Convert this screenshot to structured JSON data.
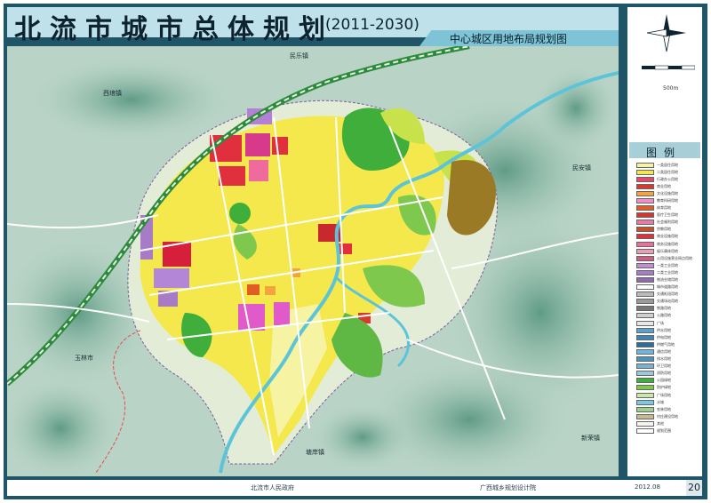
{
  "title": {
    "main": "北流市城市总体规划",
    "period": "(2011-2030)",
    "subtitle": "中心城区用地布局规划图"
  },
  "north_arrow": {
    "icon": "north-arrow-icon"
  },
  "scale_bar": {
    "icon": "scale-bar-icon",
    "label": "500m"
  },
  "legend": {
    "title": "图例",
    "items": [
      {
        "label": "一类居住用地",
        "color": "#f6f3a2"
      },
      {
        "label": "二类居住用地",
        "color": "#f4e84c"
      },
      {
        "label": "行政办公用地",
        "color": "#e5486b"
      },
      {
        "label": "商业用地",
        "color": "#d8392c"
      },
      {
        "label": "文化设施用地",
        "color": "#f3a43b"
      },
      {
        "label": "教育科研用地",
        "color": "#f28cc6"
      },
      {
        "label": "体育用地",
        "color": "#e15e23"
      },
      {
        "label": "医疗卫生用地",
        "color": "#d2372f"
      },
      {
        "label": "社会福利用地",
        "color": "#e67ba6"
      },
      {
        "label": "宗教用地",
        "color": "#c7512b"
      },
      {
        "label": "商业设施用地",
        "color": "#e0303d"
      },
      {
        "label": "商务设施用地",
        "color": "#ee6b9b"
      },
      {
        "label": "娱乐康体用地",
        "color": "#f09ab8"
      },
      {
        "label": "公用设施营业网点用地",
        "color": "#cf5a82"
      },
      {
        "label": "一类工业用地",
        "color": "#c48cd2"
      },
      {
        "label": "二类工业用地",
        "color": "#a77bc6"
      },
      {
        "label": "物流仓储用地",
        "color": "#8d6ab2"
      },
      {
        "label": "城市道路用地",
        "color": "#ffffff"
      },
      {
        "label": "交通枢纽用地",
        "color": "#b9b9b9"
      },
      {
        "label": "交通场站用地",
        "color": "#9a9a9a"
      },
      {
        "label": "铁路用地",
        "color": "#777777"
      },
      {
        "label": "公路用地",
        "color": "#cfcfcf"
      },
      {
        "label": "广场",
        "color": "#e8e8e8"
      },
      {
        "label": "供水用地",
        "color": "#5aa1c8"
      },
      {
        "label": "供电用地",
        "color": "#3e86b6"
      },
      {
        "label": "供燃气用地",
        "color": "#2d6d9b"
      },
      {
        "label": "通信用地",
        "color": "#6fb7da"
      },
      {
        "label": "排水用地",
        "color": "#4b93bf"
      },
      {
        "label": "环卫用地",
        "color": "#7ab1cf"
      },
      {
        "label": "消防用地",
        "color": "#9cc7dc"
      },
      {
        "label": "公园绿地",
        "color": "#3fae3a"
      },
      {
        "label": "防护绿地",
        "color": "#7ec84e"
      },
      {
        "label": "广场用地",
        "color": "#c9e8a3"
      },
      {
        "label": "水域",
        "color": "#78c9e3"
      },
      {
        "label": "农林用地",
        "color": "#9dd08a"
      },
      {
        "label": "村庄建设用地",
        "color": "#c9b88b"
      },
      {
        "label": "其他",
        "color": "#f4f4f4"
      },
      {
        "label": "规划范围",
        "color": "#ffffff"
      }
    ]
  },
  "places": {
    "xibeizhen": "西埌镇",
    "minlezhen": "民乐镇",
    "minanzhen": "民安镇",
    "yulinshi": "玉林市",
    "xinrongzhen": "新荣镇",
    "tangananzhen": "塘岸镇"
  },
  "footer": {
    "left": "北流市人民政府",
    "center": "广西城乡规划设计院",
    "date": "2012.08",
    "page": "20"
  },
  "colors": {
    "frame": "#1f5567",
    "title_band": "#bfe1ea",
    "terrain": "#b9d4c6",
    "river": "#5cc4d8",
    "railway": "#2c8a3c"
  }
}
